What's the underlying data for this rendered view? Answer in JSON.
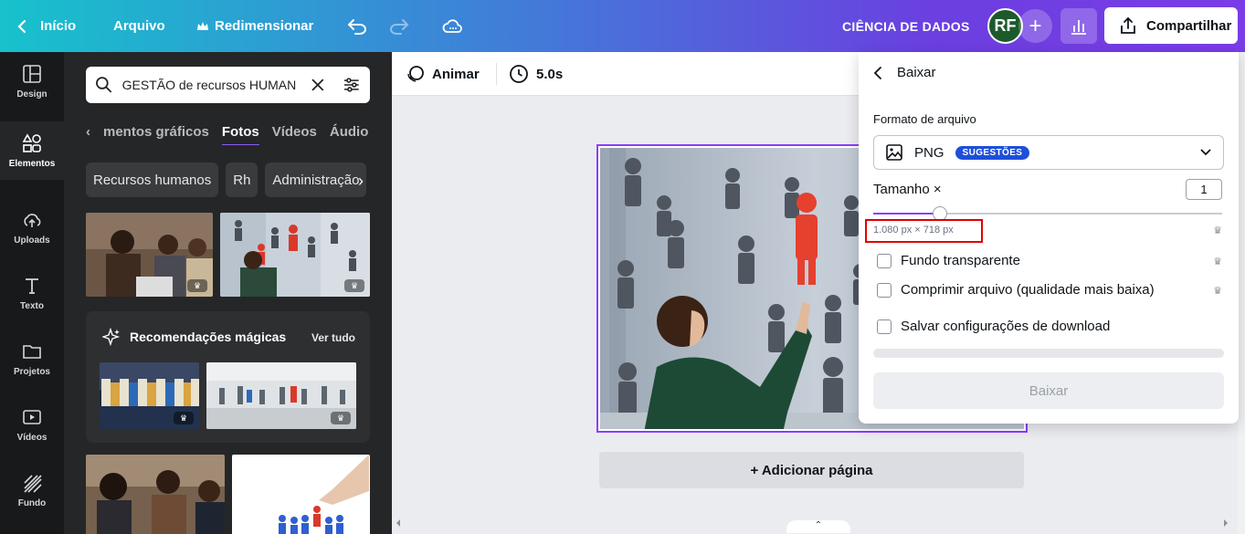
{
  "topbar": {
    "back_label": "Início",
    "file_label": "Arquivo",
    "resize_label": "Redimensionar",
    "project_title": "CIÊNCIA DE DADOS",
    "avatar_initials": "RF",
    "share_label": "Compartilhar"
  },
  "rail": {
    "items": [
      {
        "label": "Design",
        "icon": "design-icon"
      },
      {
        "label": "Elementos",
        "icon": "elements-icon"
      },
      {
        "label": "Uploads",
        "icon": "upload-icon"
      },
      {
        "label": "Texto",
        "icon": "text-icon"
      },
      {
        "label": "Projetos",
        "icon": "folder-icon"
      },
      {
        "label": "Vídeos",
        "icon": "video-icon"
      },
      {
        "label": "Fundo",
        "icon": "background-icon"
      }
    ],
    "active_index": 1
  },
  "panel": {
    "search_value": "GESTÃO de recursos HUMAN",
    "tabs": [
      "mentos gráficos",
      "Fotos",
      "Vídeos",
      "Áudio"
    ],
    "active_tab": "Fotos",
    "chips": [
      "Recursos humanos",
      "Rh",
      "Administração"
    ],
    "magic_title": "Recomendações mágicas",
    "magic_see_all": "Ver tudo"
  },
  "toolbar": {
    "animate_label": "Animar",
    "duration_label": "5.0s"
  },
  "canvas": {
    "add_page_label": "+ Adicionar página"
  },
  "download": {
    "title": "Baixar",
    "format_label": "Formato de arquivo",
    "format_value": "PNG",
    "format_badge": "SUGESTÕES",
    "size_label": "Tamanho ×",
    "size_value": "1",
    "size_slider_fraction": 0.19,
    "dimensions": "1.080 px × 718 px",
    "options": [
      {
        "label": "Fundo transparente",
        "checked": false,
        "premium": true
      },
      {
        "label": "Comprimir arquivo (qualidade mais baixa)",
        "checked": false,
        "premium": true
      },
      {
        "label": "Salvar configurações de download",
        "checked": false,
        "premium": false
      }
    ],
    "button_label": "Baixar"
  },
  "colors": {
    "accent": "#8b3dff",
    "highlight_box": "#e00000",
    "badge": "#1e4fd8"
  }
}
